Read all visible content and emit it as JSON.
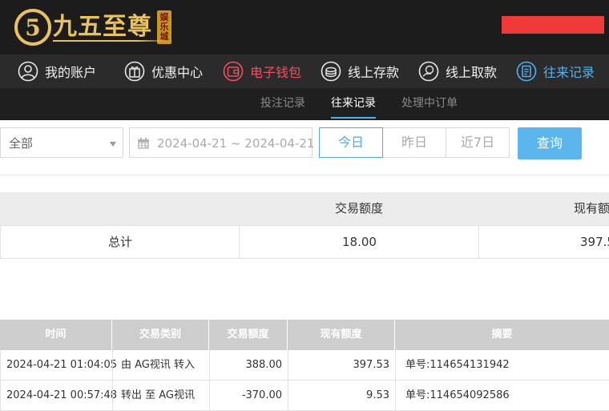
{
  "header": {
    "logo": {
      "digit": "5",
      "text": "九五至尊",
      "badge": "娱乐城"
    }
  },
  "colors": {
    "accent": "#52b0f0",
    "wallet": "#f05060",
    "gold": "#e9c25c",
    "search_button": "#5cb6ee"
  },
  "main_nav": [
    {
      "label": "我的账户",
      "icon": "user-icon"
    },
    {
      "label": "优惠中心",
      "icon": "gift-icon"
    },
    {
      "label": "电子钱包",
      "icon": "wallet-icon"
    },
    {
      "label": "线上存款",
      "icon": "deposit-icon"
    },
    {
      "label": "线上取款",
      "icon": "withdraw-icon"
    },
    {
      "label": "往来记录",
      "icon": "records-icon",
      "active": true
    }
  ],
  "sub_nav": [
    {
      "label": "投注记录"
    },
    {
      "label": "往来记录",
      "active": true
    },
    {
      "label": "处理中订单"
    }
  ],
  "filters": {
    "type_select": "全部",
    "date_range": "2024-04-21 ~ 2024-04-21",
    "quick_buttons": [
      "今日",
      "昨日",
      "近7日"
    ],
    "active_quick": "今日",
    "search_label": "查询"
  },
  "summary": {
    "headers": [
      "交易额度",
      "现有额"
    ],
    "total_label": "总计",
    "amount": "18.00",
    "balance": "397.5"
  },
  "details": {
    "headers": [
      "时间",
      "交易类别",
      "交易额度",
      "现有额度",
      "摘要"
    ],
    "rows": [
      {
        "time": "2024-04-21 01:04:05",
        "type": "由 AG视讯 转入",
        "amount": "388.00",
        "balance": "397.53",
        "memo": "单号:114654131942"
      },
      {
        "time": "2024-04-21 00:57:48",
        "type": "转出 至 AG视讯",
        "amount": "-370.00",
        "balance": "9.53",
        "memo": "单号:114654092586"
      }
    ]
  }
}
